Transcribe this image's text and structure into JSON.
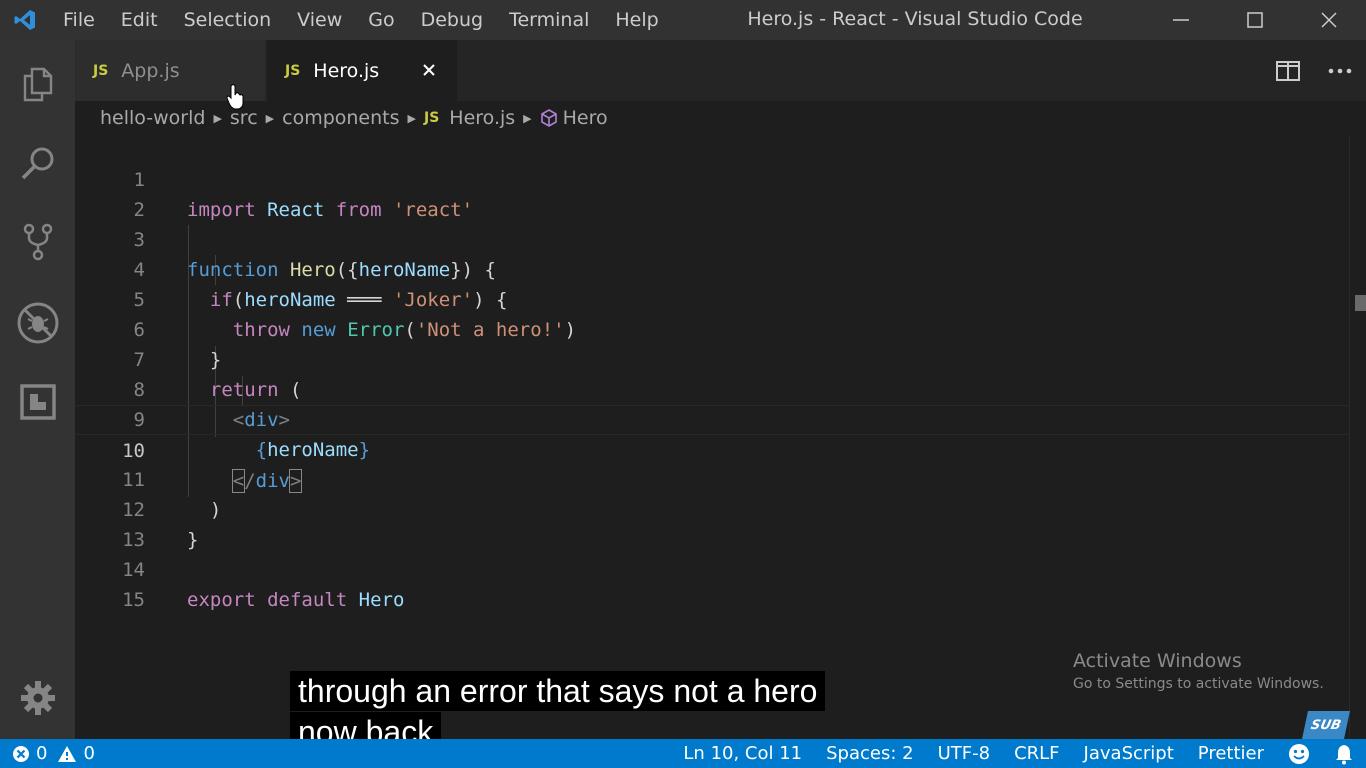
{
  "titlebar": {
    "menu": [
      "File",
      "Edit",
      "Selection",
      "View",
      "Go",
      "Debug",
      "Terminal",
      "Help"
    ],
    "window_title": "Hero.js - React - Visual Studio Code"
  },
  "tabs": [
    {
      "label": "App.js",
      "icon": "JS",
      "active": false
    },
    {
      "label": "Hero.js",
      "icon": "JS",
      "active": true
    }
  ],
  "breadcrumb": {
    "items": [
      "hello-world",
      "src",
      "components",
      "Hero.js",
      "Hero"
    ],
    "file_icon": "JS"
  },
  "editor": {
    "active_line": 10,
    "line_numbers": [
      "1",
      "2",
      "3",
      "4",
      "5",
      "6",
      "7",
      "8",
      "9",
      "10",
      "11",
      "12",
      "13",
      "14",
      "15"
    ]
  },
  "watermark": {
    "title": "Activate Windows",
    "subtitle": "Go to Settings to activate Windows."
  },
  "subtitles": {
    "line1": "through an error that says not a hero",
    "line2": "now back"
  },
  "logo_text": "SUB",
  "statusbar": {
    "errors": "0",
    "warnings": "0",
    "position": "Ln 10, Col 11",
    "spaces": "Spaces: 2",
    "encoding": "UTF-8",
    "eol": "CRLF",
    "language": "JavaScript",
    "formatter": "Prettier"
  },
  "colors": {
    "statusbar": "#007acc",
    "js_badge": "#cbcb41",
    "keyword": "#c586c0",
    "string": "#ce9178"
  }
}
